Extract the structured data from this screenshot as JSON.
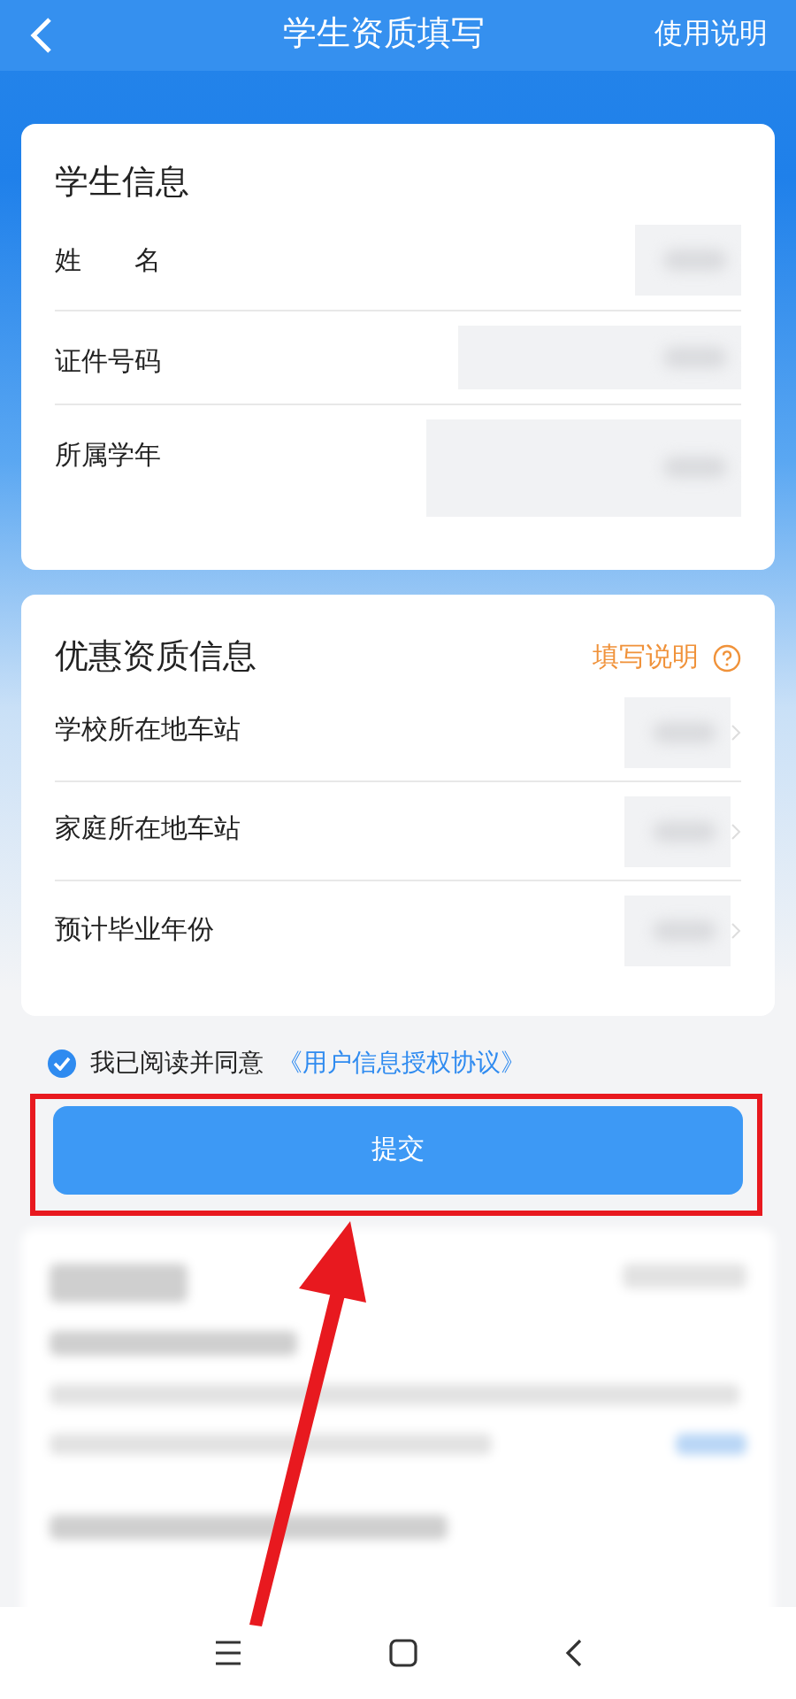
{
  "header": {
    "title": "学生资质填写",
    "action": "使用说明"
  },
  "student_info": {
    "title": "学生信息",
    "rows": [
      {
        "label": "姓　　名",
        "kind": "short"
      },
      {
        "label": "证件号码",
        "kind": "wide"
      },
      {
        "label": "所属学年",
        "kind": "tall"
      }
    ]
  },
  "discount_info": {
    "title": "优惠资质信息",
    "help": "填写说明",
    "rows": [
      {
        "label": "学校所在地车站"
      },
      {
        "label": "家庭所在地车站"
      },
      {
        "label": "预计毕业年份"
      }
    ]
  },
  "agreement": {
    "checked": true,
    "text": "我已阅读并同意",
    "link": "《用户信息授权协议》"
  },
  "submit": "提交"
}
